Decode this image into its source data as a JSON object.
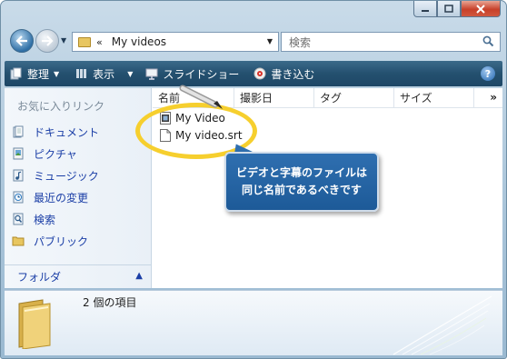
{
  "window": {
    "caption_buttons": [
      "minimize",
      "maximize",
      "close"
    ]
  },
  "address_bar": {
    "chevron": "«",
    "path": "My videos"
  },
  "search": {
    "placeholder": "検索"
  },
  "toolbar": {
    "organize": "整理",
    "views": "表示",
    "slideshow": "スライドショー",
    "burn": "書き込む",
    "help": "?"
  },
  "nav_pane": {
    "favorites_heading": "お気に入りリンク",
    "items": [
      {
        "label": "ドキュメント",
        "icon": "documents-icon"
      },
      {
        "label": "ピクチャ",
        "icon": "pictures-icon"
      },
      {
        "label": "ミュージック",
        "icon": "music-icon"
      },
      {
        "label": "最近の変更",
        "icon": "recent-changes-icon"
      },
      {
        "label": "検索",
        "icon": "searches-icon"
      },
      {
        "label": "パブリック",
        "icon": "public-folder-icon"
      }
    ],
    "folders_label": "フォルダ"
  },
  "columns": {
    "name": "名前",
    "date": "撮影日",
    "tag": "タグ",
    "size": "サイズ",
    "more": "»"
  },
  "files": [
    {
      "name": "My Video",
      "icon": "video-file-icon"
    },
    {
      "name": "My video.srt",
      "icon": "text-file-icon"
    }
  ],
  "callout": {
    "line1": "ビデオと字幕のファイルは",
    "line2": "同じ名前であるべきです"
  },
  "details": {
    "item_count": "2 個の項目"
  },
  "colors": {
    "highlight_ellipse": "#f6cf2e",
    "callout_bg": "#2567a8",
    "link_text": "#1a3ea6",
    "toolbar_bg": "#24506f"
  }
}
